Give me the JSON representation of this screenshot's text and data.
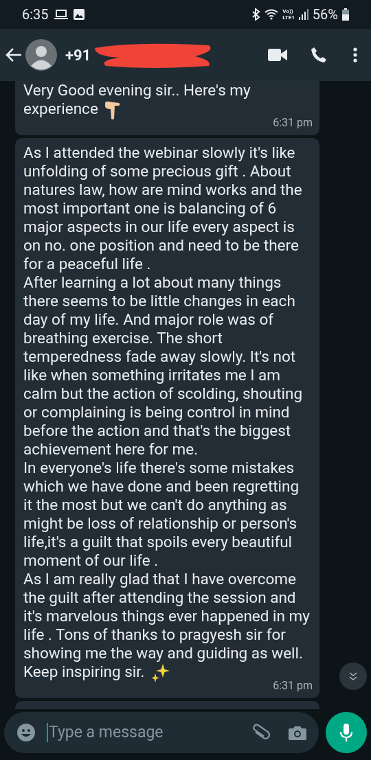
{
  "status_bar": {
    "time": "6:35",
    "network": "Vo))\nLTE1",
    "battery": "56%"
  },
  "header": {
    "contact": "+91",
    "redacted": true
  },
  "messages": [
    {
      "paragraphs": [
        "Very Good evening sir.. Here's  my experience"
      ],
      "kind": "hand",
      "time": "6:31 pm"
    },
    {
      "paragraphs": [
        "As I attended the webinar slowly it's like unfolding of some precious gift . About natures law,  how are mind works and the most important one is balancing of 6 major aspects in our life every aspect is on no. one position and need to be there for a peaceful life .",
        "After learning a lot about many things there seems to be little changes in each day of my life. And  major role was of breathing exercise. The short temperedness fade away slowly. It's not like when something irritates me I am calm but the action of scolding, shouting or complaining is being control in mind before the action and that's the biggest achievement here for me.",
        "In everyone's life there's some mistakes which we have done and been regretting it the most but we can't do anything as might be loss of relationship or person's life,it's a guilt that spoils every beautiful moment of our life .",
        "As I am really glad that I have overcome the guilt after attending the session and it's marvelous things ever happened in my life . Tons of thanks to pragyesh sir for showing me the way and guiding as well.",
        "Keep inspiring sir."
      ],
      "kind": "sparkles",
      "time": "6:31 pm"
    }
  ],
  "composer": {
    "placeholder": "Type a message"
  }
}
